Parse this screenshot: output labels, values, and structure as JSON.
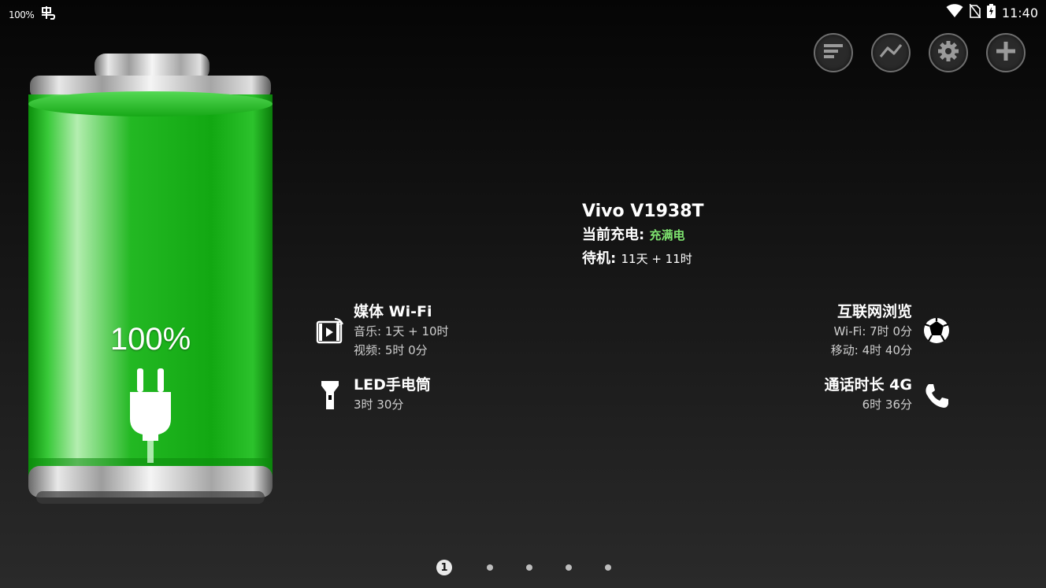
{
  "status_bar": {
    "battery_text": "100%",
    "time": "11:40"
  },
  "battery": {
    "percent": "100%",
    "level": 1.0,
    "state": "charging",
    "fill_color": "#14c814"
  },
  "device": {
    "name": "Vivo V1938T",
    "charge_label": "当前充电:",
    "charge_value": "充满电",
    "standby_label": "待机:",
    "standby_value": "11天 + 11时"
  },
  "usage": {
    "media_wifi": {
      "title": "媒体 Wi-Fi",
      "music": "音乐: 1天 + 10时",
      "video": "视频: 5时 0分",
      "icon": "media-icon"
    },
    "led_flashlight": {
      "title": "LED手电筒",
      "value": "3时 30分",
      "icon": "flashlight-icon"
    },
    "internet": {
      "title": "互联网浏览",
      "wifi": "Wi-Fi: 7时 0分",
      "mobile": "移动: 4时 40分",
      "icon": "globe-icon"
    },
    "call": {
      "title": "通话时长 4G",
      "value": "6时 36分",
      "icon": "phone-icon"
    }
  },
  "pager": {
    "current": "1",
    "total": 5
  },
  "colors": {
    "accent_green": "#7ee36f",
    "battery_green": "#14c814"
  }
}
